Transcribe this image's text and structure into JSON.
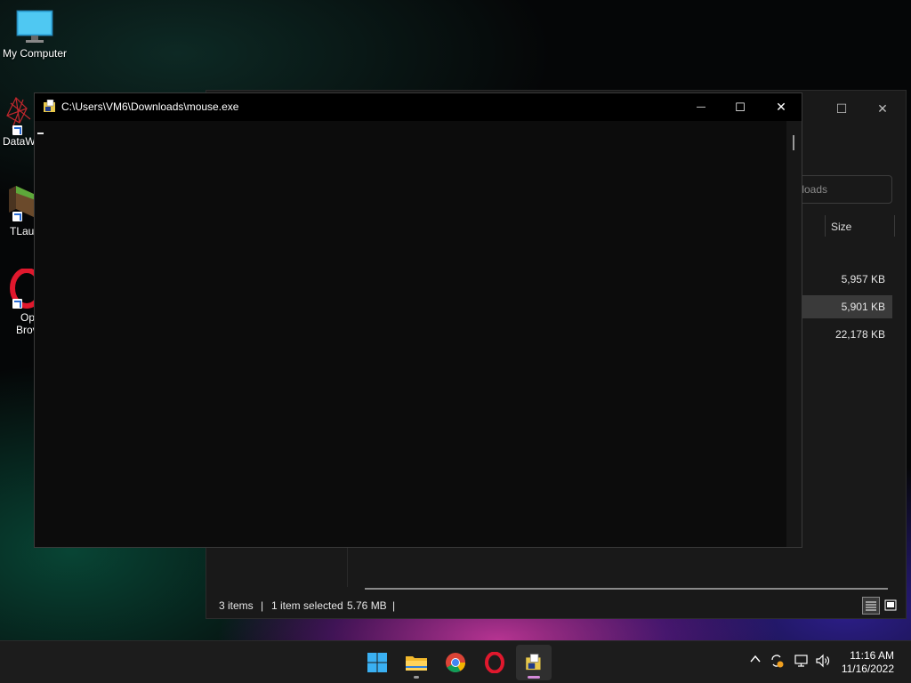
{
  "desktop": {
    "icons": [
      {
        "label": "My Computer"
      },
      {
        "label": "DataW"
      },
      {
        "label": "TLaun"
      },
      {
        "label1": "Op",
        "label2": "Brov"
      }
    ]
  },
  "explorer": {
    "search_placeholder": "wnloads",
    "column_size": "Size",
    "sizes": [
      "5,957 KB",
      "5,901 KB",
      "22,178 KB"
    ],
    "status_items": "3 items",
    "status_selected": "1 item selected",
    "status_size": "5.76 MB"
  },
  "console": {
    "title": "C:\\Users\\VM6\\Downloads\\mouse.exe",
    "minimize": "—",
    "maximize": "☐",
    "close": "✕"
  },
  "taskbar": {
    "time": "11:16 AM",
    "date": "11/16/2022"
  },
  "colors": {
    "console_bg": "#0c0c0c",
    "taskbar_bg": "#1c1c1c",
    "accent": "#d58ad9"
  }
}
